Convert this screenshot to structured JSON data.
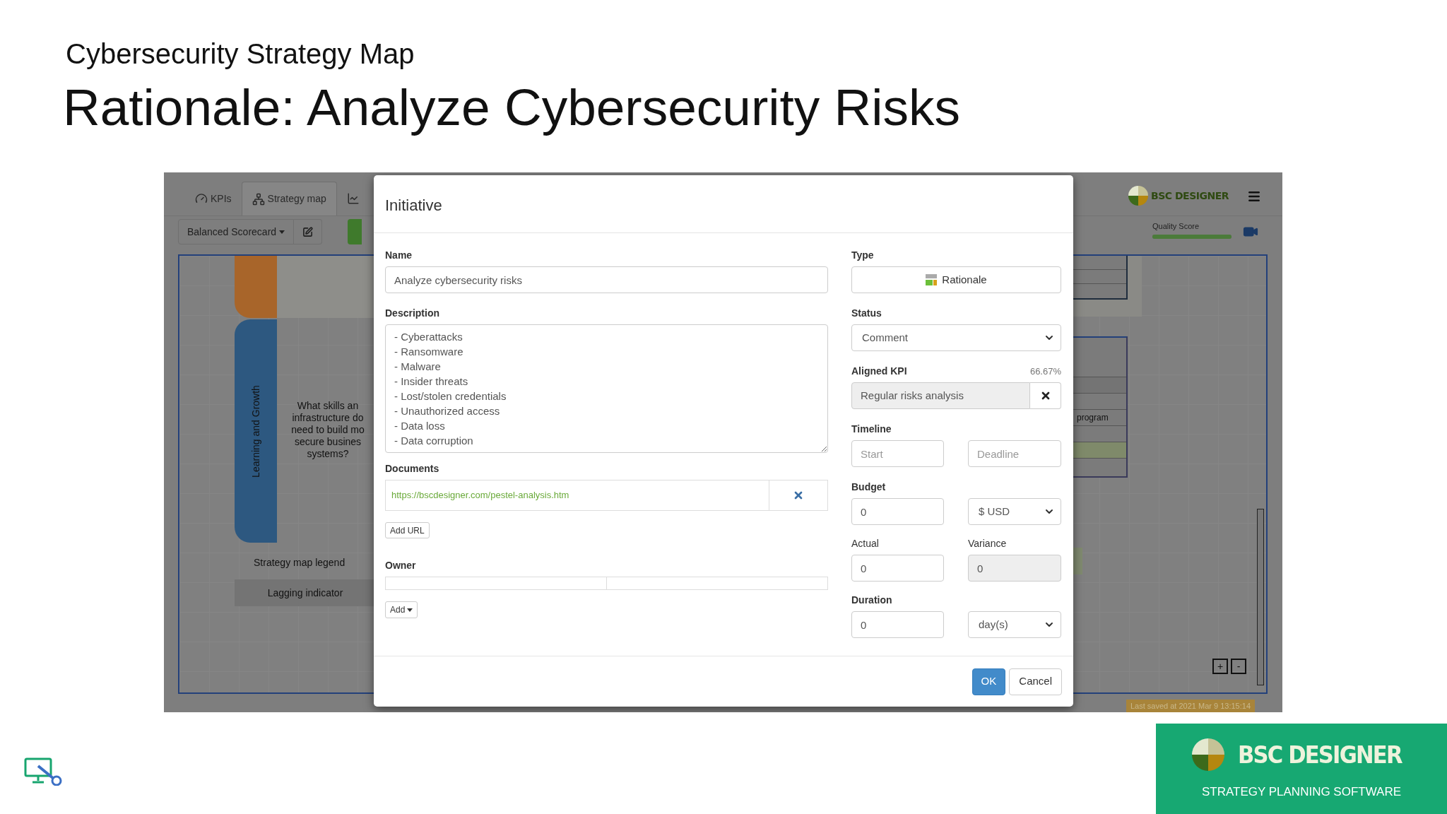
{
  "slide": {
    "subtitle": "Cybersecurity Strategy Map",
    "title": "Rationale: Analyze Cybersecurity Risks"
  },
  "app": {
    "tabs": [
      {
        "label": "KPIs",
        "kind": "kpis",
        "selected": false
      },
      {
        "label": "Strategy map",
        "kind": "map",
        "selected": true
      },
      {
        "kind": "chart",
        "selected": false
      }
    ],
    "scorecard_menu": "Balanced Scorecard",
    "logo": "BSC DESIGNER",
    "quality_score": {
      "label": "Quality Score",
      "level": 1
    },
    "perspectives": [
      {
        "color": "#a8652a"
      },
      {
        "label": "Learning and Growth",
        "color": "#2d5880"
      }
    ],
    "perspective_question": "What skills an\ninfrastructure do\nneed to build mo\nsecure busines\nsystems?",
    "legend": {
      "title": "Strategy map legend",
      "items": [
        "Lagging indicator"
      ]
    },
    "map_item_text": "program",
    "zoom_buttons": [
      "+",
      "-"
    ],
    "last_saved": "Last saved at 2021 Mar 9 13:15:14"
  },
  "dialog": {
    "title": "Initiative",
    "name": {
      "label": "Name",
      "value": "Analyze cybersecurity risks"
    },
    "description": {
      "label": "Description",
      "lines": [
        "- Cyberattacks",
        "- Ransomware",
        "- Malware",
        "- Insider threats",
        "- Lost/stolen credentials",
        "- Unauthorized access",
        "- Data loss",
        "- Data corruption"
      ]
    },
    "documents": {
      "label": "Documents",
      "urls": [
        "https://bscdesigner.com/pestel-analysis.htm"
      ],
      "add_button": "Add URL"
    },
    "owner": {
      "label": "Owner",
      "add_button": "Add"
    },
    "type": {
      "label": "Type",
      "value": "Rationale"
    },
    "status": {
      "label": "Status",
      "value": "Comment"
    },
    "aligned_kpi": {
      "label": "Aligned KPI",
      "percent": "66.67%",
      "value": "Regular risks analysis"
    },
    "timeline": {
      "label": "Timeline",
      "start_placeholder": "Start",
      "deadline_placeholder": "Deadline"
    },
    "budget": {
      "label": "Budget",
      "value": "0",
      "currency": "$ USD"
    },
    "actual": {
      "label": "Actual",
      "value": "0"
    },
    "variance": {
      "label": "Variance",
      "value": "0",
      "disabled": true
    },
    "duration": {
      "label": "Duration",
      "value": "0",
      "unit": "day(s)"
    },
    "buttons": {
      "ok": "OK",
      "cancel": "Cancel"
    }
  },
  "footer_logo": {
    "name": "BSC DESIGNER",
    "tagline": "STRATEGY PLANNING SOFTWARE"
  }
}
